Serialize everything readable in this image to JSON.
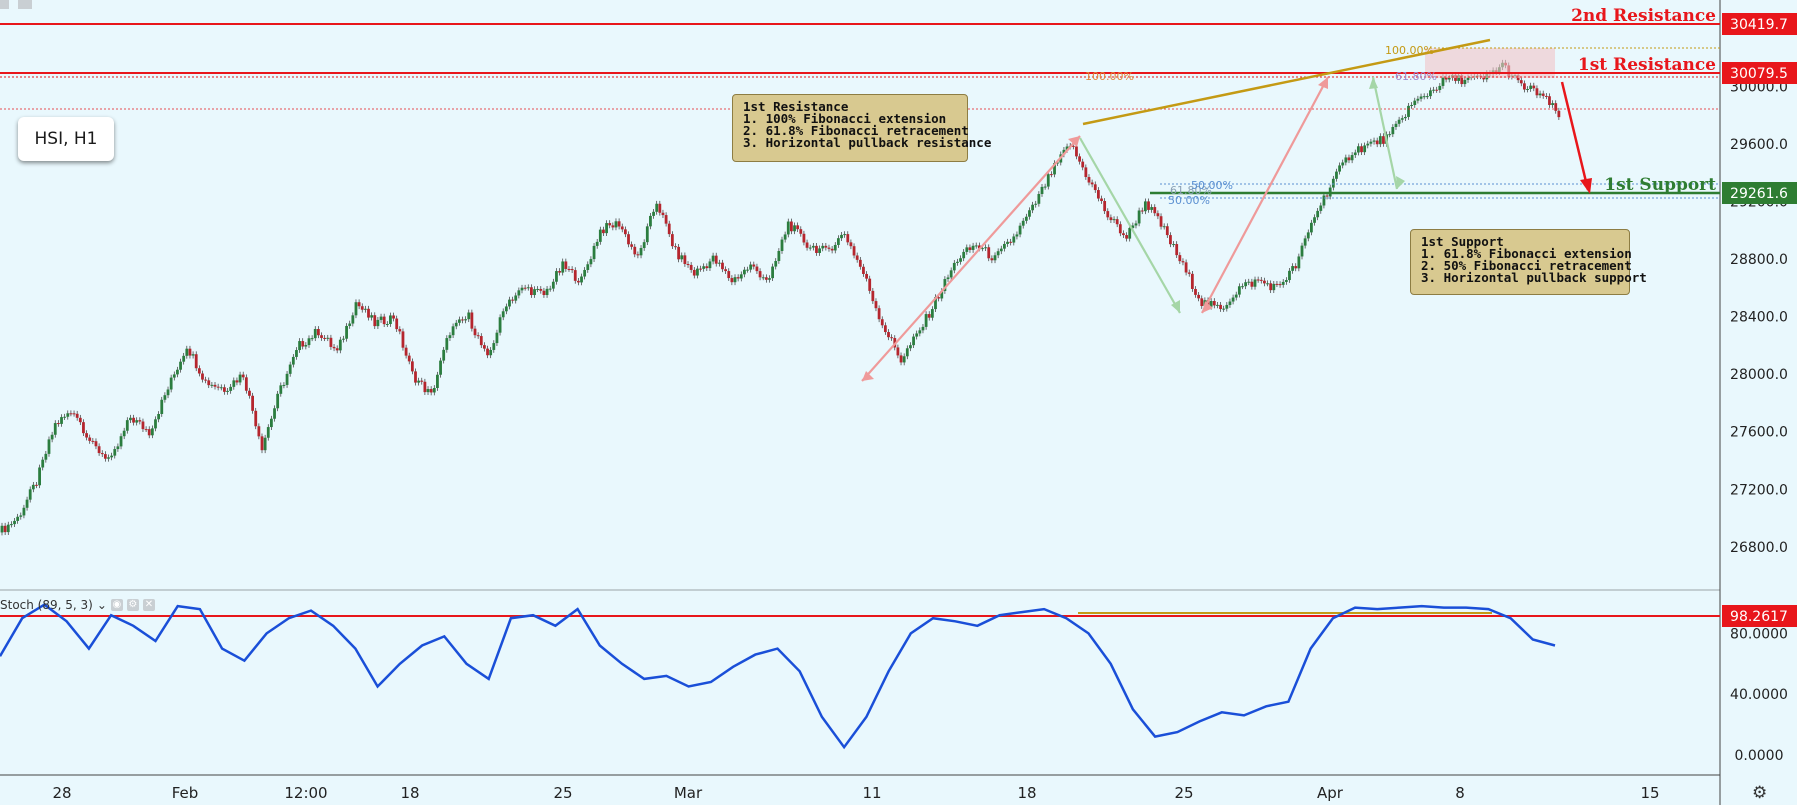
{
  "symbol": "HSI, H1",
  "levels": {
    "resistance2": {
      "label": "2nd Resistance",
      "price": "30419.7",
      "value": 30419.7
    },
    "resistance1": {
      "label": "1st Resistance",
      "price": "30079.5",
      "value": 30079.5
    },
    "support1": {
      "label": "1st Support",
      "price": "29261.6",
      "value": 29261.6
    }
  },
  "fib_labels": {
    "ext_100_top": "100.00%",
    "ext_100_mid": "100.00%",
    "ret_618_top": "61.80%",
    "ext_618_sup": "61.80%",
    "ret_50_sup": "50.00%",
    "ret_50_sup2": "50.00%"
  },
  "notes": {
    "resistance": {
      "title": "1st Resistance",
      "lines": [
        "1. 100% Fibonacci extension",
        "2. 61.8% Fibonacci retracement",
        "3. Horizontal pullback resistance"
      ]
    },
    "support": {
      "title": "1st Support",
      "lines": [
        "1. 61.8% Fibonacci extension",
        "2. 50% Fibonacci retracement",
        "3. Horizontal pullback support"
      ]
    }
  },
  "indicator": {
    "name": "Stoch (89, 5, 3)",
    "level_label": "98.2617",
    "level": 98.2617
  },
  "colors": {
    "background": "#e9f8fd",
    "resistance": "#e8161b",
    "support": "#2e7d32",
    "trendline": "#c49a14",
    "stoch": "#1a4fd8",
    "bull": "#2b7d3f",
    "bear": "#b5262e"
  },
  "chart_data": [
    {
      "type": "line",
      "subtype": "candlestick",
      "title": "HSI, H1",
      "x_ticks": [
        "28",
        "Feb",
        "12:00",
        "18",
        "25",
        "Mar",
        "11",
        "18",
        "25",
        "Apr",
        "8",
        "15"
      ],
      "y_ticks": [
        26800,
        27200,
        27600,
        28000,
        28400,
        28800,
        29200,
        29600,
        30000
      ],
      "ylim": [
        26500,
        30600
      ],
      "series": [
        {
          "values": [
            26900,
            27000,
            27250,
            27650,
            27750,
            27500,
            27400,
            27700,
            27600,
            27900,
            28200,
            27950,
            27900,
            28000,
            27500,
            27900,
            28200,
            28300,
            28150,
            28500,
            28350,
            28400,
            28000,
            27850,
            28300,
            28400,
            28100,
            28500,
            28600,
            28550,
            28750,
            28650,
            29000,
            29050,
            28800,
            29200,
            28850,
            28700,
            28800,
            28650,
            28750,
            28650,
            29050,
            28900,
            28850,
            28980,
            28700,
            28350,
            28100,
            28300,
            28550,
            28800,
            28900,
            28800,
            28950,
            29150,
            29400,
            29600,
            29350,
            29100,
            28950,
            29200,
            29000,
            28750,
            28500,
            28450,
            28600,
            28650,
            28600,
            28750,
            29100,
            29350,
            29550,
            29600,
            29650,
            29850,
            29950,
            30050,
            30050,
            30050,
            30150,
            30000,
            29950,
            29800
          ]
        }
      ]
    },
    {
      "type": "line",
      "title": "Stoch (89, 5, 3)",
      "y_ticks": [
        0,
        40,
        80
      ],
      "ylim": [
        -10,
        102
      ],
      "series": [
        {
          "values": [
            65,
            90,
            99,
            88,
            70,
            92,
            85,
            75,
            98,
            96,
            70,
            62,
            80,
            90,
            95,
            85,
            70,
            45,
            60,
            72,
            78,
            60,
            50,
            90,
            92,
            85,
            96,
            72,
            60,
            50,
            52,
            45,
            48,
            58,
            66,
            70,
            55,
            25,
            5,
            25,
            55,
            80,
            90,
            88,
            85,
            92,
            94,
            96,
            90,
            80,
            60,
            30,
            12,
            15,
            22,
            28,
            26,
            32,
            35,
            70,
            90,
            97,
            96,
            97,
            98,
            97,
            97,
            96,
            90,
            76,
            72
          ]
        }
      ]
    }
  ]
}
